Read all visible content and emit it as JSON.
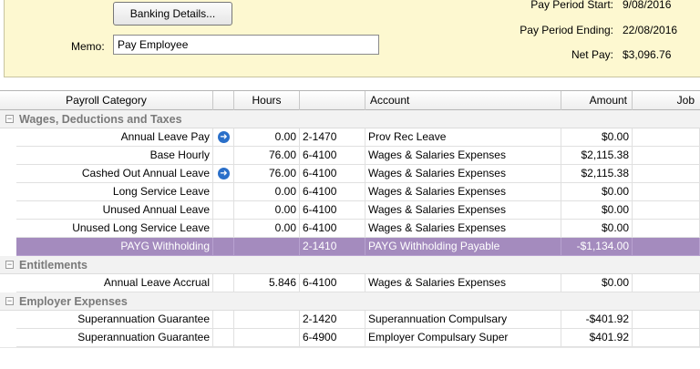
{
  "header": {
    "banking_button": "Banking Details...",
    "memo_label": "Memo:",
    "memo_value": "Pay Employee",
    "pay_period_start_label": "Pay Period Start:",
    "pay_period_start_value": "9/08/2016",
    "pay_period_end_label": "Pay Period Ending:",
    "pay_period_end_value": "22/08/2016",
    "net_pay_label": "Net Pay:",
    "net_pay_value": "$3,096.76"
  },
  "grid": {
    "columns": {
      "category": "Payroll Category",
      "hours": "Hours",
      "account": "Account",
      "amount": "Amount",
      "job": "Job"
    },
    "groups": [
      {
        "label": "Wages, Deductions and Taxes",
        "toggle": "−",
        "rows": [
          {
            "category": "Annual Leave Pay",
            "icon": true,
            "hours": "0.00",
            "account": "2-1470",
            "account_name": "Prov Rec Leave",
            "amount": "$0.00",
            "job": ""
          },
          {
            "category": "Base Hourly",
            "icon": false,
            "hours": "76.00",
            "account": "6-4100",
            "account_name": "Wages & Salaries Expenses",
            "amount": "$2,115.38",
            "job": ""
          },
          {
            "category": "Cashed Out Annual Leave",
            "icon": true,
            "hours": "76.00",
            "account": "6-4100",
            "account_name": "Wages & Salaries Expenses",
            "amount": "$2,115.38",
            "job": ""
          },
          {
            "category": "Long Service Leave",
            "icon": false,
            "hours": "0.00",
            "account": "6-4100",
            "account_name": "Wages & Salaries Expenses",
            "amount": "$0.00",
            "job": ""
          },
          {
            "category": "Unused Annual Leave",
            "icon": false,
            "hours": "0.00",
            "account": "6-4100",
            "account_name": "Wages & Salaries Expenses",
            "amount": "$0.00",
            "job": ""
          },
          {
            "category": "Unused Long Service Leave",
            "icon": false,
            "hours": "0.00",
            "account": "6-4100",
            "account_name": "Wages & Salaries Expenses",
            "amount": "$0.00",
            "job": ""
          },
          {
            "category": "PAYG Withholding",
            "icon": false,
            "hours": "",
            "account": "2-1410",
            "account_name": "PAYG Withholding Payable",
            "amount": "-$1,134.00",
            "job": "",
            "selected": true
          }
        ]
      },
      {
        "label": "Entitlements",
        "toggle": "−",
        "rows": [
          {
            "category": "Annual Leave Accrual",
            "icon": false,
            "hours": "5.846",
            "account": "6-4100",
            "account_name": "Wages & Salaries Expenses",
            "amount": "$0.00",
            "job": ""
          }
        ]
      },
      {
        "label": "Employer Expenses",
        "toggle": "−",
        "rows": [
          {
            "category": "Superannuation Guarantee",
            "icon": false,
            "hours": "",
            "account": "2-1420",
            "account_name": "Superannuation Compulsary",
            "amount": "-$401.92",
            "job": ""
          },
          {
            "category": "Superannuation Guarantee",
            "icon": false,
            "hours": "",
            "account": "6-4900",
            "account_name": "Employer Compulsary Super",
            "amount": "$401.92",
            "job": ""
          }
        ]
      }
    ]
  },
  "icons": {
    "row_detail_icon": "➜"
  }
}
